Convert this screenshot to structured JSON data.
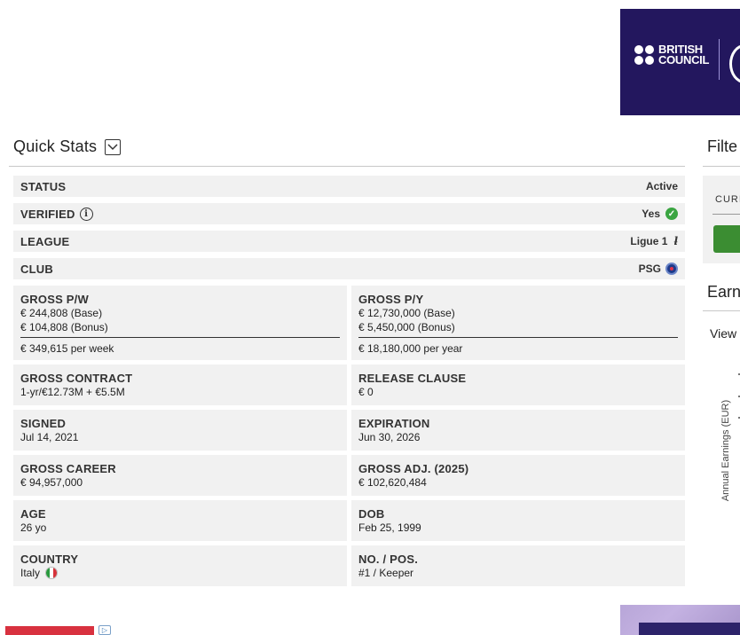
{
  "ad_banner": {
    "brand_line1": "BRITISH",
    "brand_line2": "COUNCIL",
    "colors": {
      "background": "#23175e",
      "text": "#ffffff"
    }
  },
  "quick_stats": {
    "title": "Quick Stats",
    "toggle_icon": "chevron-down-icon",
    "rows": [
      {
        "label": "STATUS",
        "value": "Active"
      },
      {
        "label": "VERIFIED",
        "value": "Yes",
        "label_icon": "info-icon",
        "value_icon": "check-circle-icon"
      },
      {
        "label": "LEAGUE",
        "value": "Ligue 1",
        "value_icon": "ligue1-logo-icon"
      },
      {
        "label": "CLUB",
        "value": "PSG",
        "value_icon": "psg-crest-icon"
      }
    ],
    "cards": {
      "gross_pw": {
        "label": "GROSS P/W",
        "base": "€ 244,808 (Base)",
        "bonus": "€ 104,808 (Bonus)",
        "total": "€ 349,615 per week"
      },
      "gross_py": {
        "label": "GROSS P/Y",
        "base": "€ 12,730,000 (Base)",
        "bonus": "€ 5,450,000 (Bonus)",
        "total": "€ 18,180,000 per year"
      },
      "gross_contract": {
        "label": "GROSS CONTRACT",
        "value": "1-yr/€12.73M + €5.5M"
      },
      "release_clause": {
        "label": "RELEASE CLAUSE",
        "value": "€ 0"
      },
      "signed": {
        "label": "SIGNED",
        "value": "Jul 14, 2021"
      },
      "expiration": {
        "label": "EXPIRATION",
        "value": "Jun 30, 2026"
      },
      "gross_career": {
        "label": "GROSS CAREER",
        "value": "€ 94,957,000"
      },
      "gross_adj": {
        "label": "GROSS ADJ. (2025)",
        "value": "€ 102,620,484"
      },
      "age": {
        "label": "AGE",
        "value": "26 yo"
      },
      "dob": {
        "label": "DOB",
        "value": "Feb 25, 1999"
      },
      "country": {
        "label": "COUNTRY",
        "value": "Italy",
        "icon": "italy-flag-icon"
      },
      "no_pos": {
        "label": "NO. / POS.",
        "value": "#1 / Keeper"
      }
    }
  },
  "filters": {
    "title": "Filte",
    "field_label": "CURI",
    "button_color": "#3b8d32"
  },
  "earnings": {
    "title": "Earn",
    "view_label": "View",
    "y_axis_label": "Annual Earnings (EUR)"
  },
  "colors": {
    "row_bg": "#f1f1f1",
    "check_green": "#3aa541",
    "ad_red": "#d8313f"
  }
}
